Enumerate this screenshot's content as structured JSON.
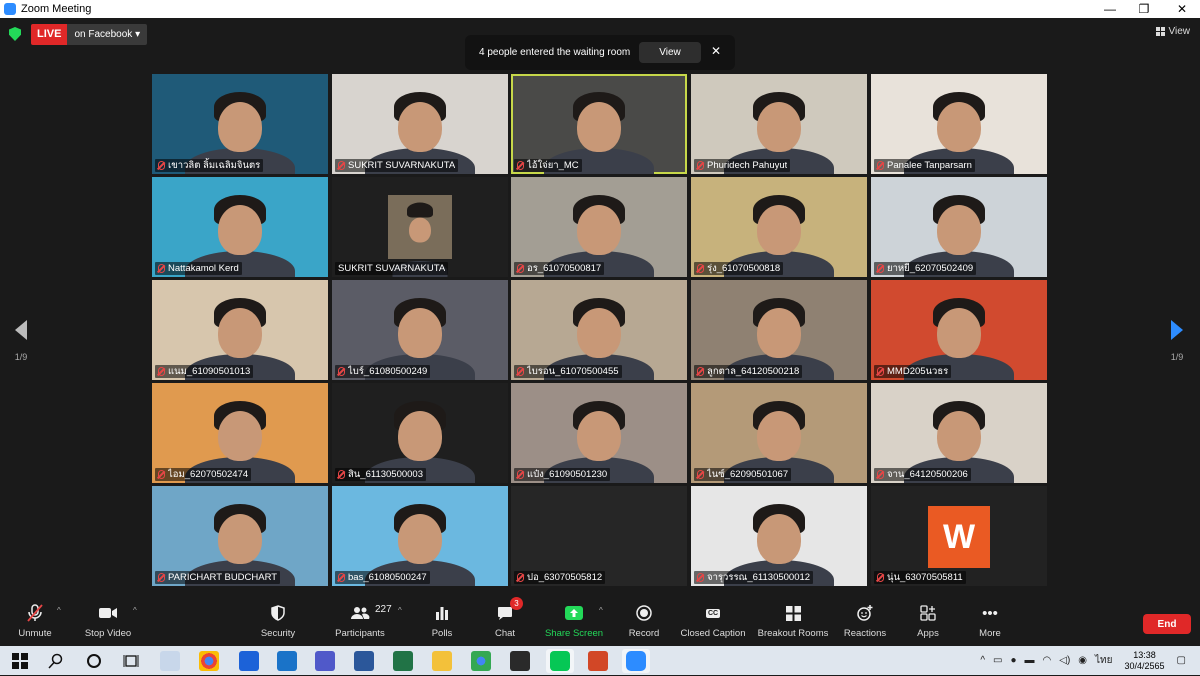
{
  "window": {
    "title": "Zoom Meeting",
    "minimize": "—",
    "maximize": "❐",
    "close": "✕"
  },
  "top": {
    "live": "LIVE",
    "live_target": "on Facebook",
    "live_caret": "▾",
    "view": "View"
  },
  "notification": {
    "message": "4 people entered the waiting room",
    "button": "View",
    "close": "✕"
  },
  "pager": {
    "left": "1/9",
    "right": "1/9"
  },
  "tiles": [
    {
      "name": "เขาวลิต ลิ้มเฉลิมจินตร",
      "bg": "#1f5a78"
    },
    {
      "name": "SUKRIT SUVARNAKUTA",
      "bg": "#d8d4cf"
    },
    {
      "name": "ไอ้ใจ่ยา_MC",
      "bg": "#4a4a48"
    },
    {
      "name": "Phuridech Pahuyut",
      "bg": "#cfc9bd"
    },
    {
      "name": "Panalee Tanparsarn",
      "bg": "#e8e2da"
    },
    {
      "name": "Nattakamol Kerd",
      "bg": "#3aa5c8"
    },
    {
      "name": "SUKRIT SUVARNAKUTA",
      "bg": "#1f1f1f"
    },
    {
      "name": "อร_61070500817",
      "bg": "#a39e94"
    },
    {
      "name": "รุ่ง_61070500818",
      "bg": "#c7b27c"
    },
    {
      "name": "ยาหยี_62070502409",
      "bg": "#cdd3d8"
    },
    {
      "name": "แนม_61090501013",
      "bg": "#d7c6ad"
    },
    {
      "name": "ไบร์_61080500249",
      "bg": "#5b5c66"
    },
    {
      "name": "ไบรอน_61070500455",
      "bg": "#b7a893"
    },
    {
      "name": "ลูกตาล_64120500218",
      "bg": "#8f8172"
    },
    {
      "name": "MMD205นวธร",
      "bg": "#d14a2f"
    },
    {
      "name": "ไอม_62070502474",
      "bg": "#e09a4f"
    },
    {
      "name": "สิน_61130500003",
      "bg": "#1f1f1f"
    },
    {
      "name": "แป๋ง_61090501230",
      "bg": "#9c8f87"
    },
    {
      "name": "ไนซ์_62090501067",
      "bg": "#b49a78"
    },
    {
      "name": "จาน_64120500206",
      "bg": "#d9d2c8"
    },
    {
      "name": "PARICHART BUDCHART",
      "bg": "#6fa6c7"
    },
    {
      "name": "bas_61080500247",
      "bg": "#6bb8e0"
    },
    {
      "name": "ปอ_63070505812",
      "bg": "#262626"
    },
    {
      "name": "จารุวรรณ_61130500012",
      "bg": "#e6e6e6"
    },
    {
      "name": "นุ่น_63070505811",
      "bg": "#222222",
      "logo": "W"
    }
  ],
  "toolbar": {
    "unmute": "Unmute",
    "stop_video": "Stop Video",
    "security": "Security",
    "participants": "Participants",
    "participants_count": "227",
    "polls": "Polls",
    "chat": "Chat",
    "chat_badge": "3",
    "share_screen": "Share Screen",
    "record": "Record",
    "closed_caption": "Closed Caption",
    "breakout_rooms": "Breakout Rooms",
    "reactions": "Reactions",
    "apps": "Apps",
    "more": "More",
    "end": "End",
    "caret": "^",
    "cc_icon": "CC",
    "more_icon": "•••"
  },
  "taskbar": {
    "time": "13:38",
    "date": "30/4/2565",
    "lang": "ไทย"
  },
  "colors": {
    "accent": "#2D8CFF",
    "live": "#e02828",
    "share": "#23d959",
    "active_speaker": "#c7d84a"
  }
}
